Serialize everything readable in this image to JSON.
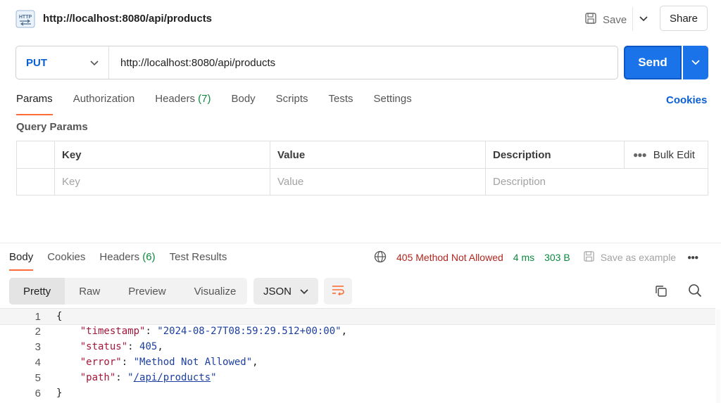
{
  "header": {
    "title": "http://localhost:8080/api/products",
    "save_label": "Save",
    "share_label": "Share",
    "http_badge": "HTTP"
  },
  "request": {
    "method": "PUT",
    "url": "http://localhost:8080/api/products",
    "send_label": "Send"
  },
  "req_tabs": {
    "params": "Params",
    "authorization": "Authorization",
    "headers": "Headers",
    "headers_count": "(7)",
    "body": "Body",
    "scripts": "Scripts",
    "tests": "Tests",
    "settings": "Settings",
    "cookies": "Cookies"
  },
  "query_params": {
    "title": "Query Params",
    "columns": {
      "key": "Key",
      "value": "Value",
      "description": "Description"
    },
    "bulk_edit": "Bulk Edit",
    "placeholder": {
      "key": "Key",
      "value": "Value",
      "description": "Description"
    }
  },
  "response": {
    "tabs": {
      "body": "Body",
      "cookies": "Cookies",
      "headers": "Headers",
      "headers_count": "(6)",
      "test_results": "Test Results"
    },
    "status": "405 Method Not Allowed",
    "time": "4 ms",
    "size": "303 B",
    "save_example": "Save as example",
    "views": {
      "pretty": "Pretty",
      "raw": "Raw",
      "preview": "Preview",
      "visualize": "Visualize"
    },
    "format": "JSON",
    "code": {
      "open": "{",
      "close": "}",
      "line_numbers": [
        "1",
        "2",
        "3",
        "4",
        "5",
        "6"
      ],
      "timestamp_key": "\"timestamp\"",
      "timestamp_val": "\"2024-08-27T08:59:29.512+00:00\"",
      "status_key": "\"status\"",
      "status_val": "405",
      "error_key": "\"error\"",
      "error_val": "\"Method Not Allowed\"",
      "path_key": "\"path\"",
      "path_val": "/api/products"
    }
  },
  "colors": {
    "accent": "#ff6c37",
    "primary": "#1a73e8",
    "error": "#b3261e",
    "success": "#0b8a3f"
  }
}
